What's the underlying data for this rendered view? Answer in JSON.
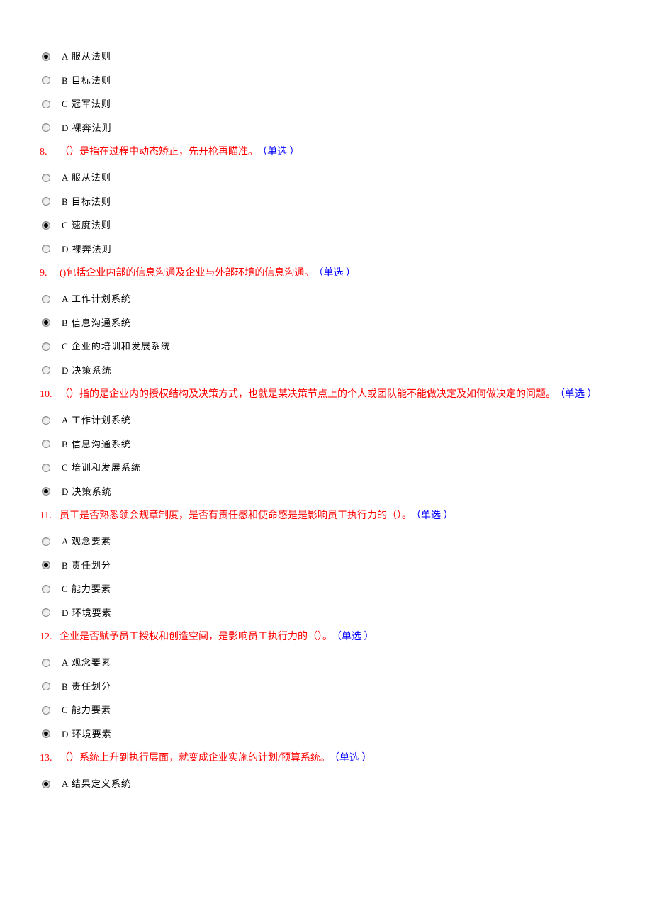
{
  "questions": [
    {
      "number": "",
      "text": "",
      "type": "",
      "options": [
        {
          "label": "A 服从法则",
          "selected": true
        },
        {
          "label": "B 目标法则",
          "selected": false
        },
        {
          "label": "C 冠军法则",
          "selected": false
        },
        {
          "label": "D 裸奔法则",
          "selected": false
        }
      ]
    },
    {
      "number": "8.",
      "text": "（）是指在过程中动态矫正，先开枪再瞄准。",
      "type": "（单选 ）",
      "options": [
        {
          "label": "A 服从法则",
          "selected": false
        },
        {
          "label": "B 目标法则",
          "selected": false
        },
        {
          "label": "C 速度法则",
          "selected": true
        },
        {
          "label": "D 裸奔法则",
          "selected": false
        }
      ]
    },
    {
      "number": "9.",
      "text": "()包括企业内部的信息沟通及企业与外部环境的信息沟通。",
      "type": "（单选 ）",
      "options": [
        {
          "label": "A 工作计划系统",
          "selected": false
        },
        {
          "label": "B 信息沟通系统",
          "selected": true
        },
        {
          "label": "C 企业的培训和发展系统",
          "selected": false
        },
        {
          "label": "D 决策系统",
          "selected": false
        }
      ]
    },
    {
      "number": "10.",
      "text": "（）指的是企业内的授权结构及决策方式，也就是某决策节点上的个人或团队能不能做决定及如何做决定的问题。",
      "type": "（单选 ）",
      "options": [
        {
          "label": "A 工作计划系统",
          "selected": false
        },
        {
          "label": "B 信息沟通系统",
          "selected": false
        },
        {
          "label": "C 培训和发展系统",
          "selected": false
        },
        {
          "label": "D 决策系统",
          "selected": true
        }
      ]
    },
    {
      "number": "11.",
      "text": "员工是否熟悉领会规章制度，是否有责任感和使命感是是影响员工执行力的（）。",
      "type": "（单选 ）",
      "options": [
        {
          "label": "A 观念要素",
          "selected": false
        },
        {
          "label": "B 责任划分",
          "selected": true
        },
        {
          "label": "C 能力要素",
          "selected": false
        },
        {
          "label": "D 环境要素",
          "selected": false
        }
      ]
    },
    {
      "number": "12.",
      "text": "企业是否赋予员工授权和创造空间，是影响员工执行力的（）。",
      "type": "（单选 ）",
      "options": [
        {
          "label": "A 观念要素",
          "selected": false
        },
        {
          "label": "B 责任划分",
          "selected": false
        },
        {
          "label": "C 能力要素",
          "selected": false
        },
        {
          "label": "D 环境要素",
          "selected": true
        }
      ]
    },
    {
      "number": "13.",
      "text": "（）系统上升到执行层面，就变成企业实施的计划/预算系统。",
      "type": "（单选 ）",
      "options": [
        {
          "label": "A 结果定义系统",
          "selected": true
        }
      ]
    }
  ]
}
